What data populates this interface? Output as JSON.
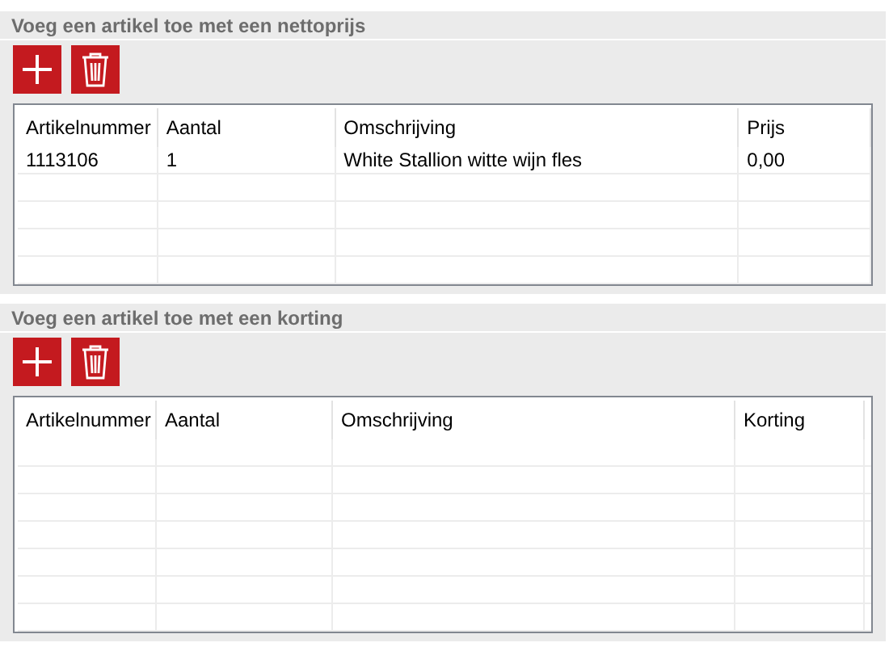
{
  "sections": [
    {
      "title": "Voeg een artikel toe met een nettoprijs",
      "columns": [
        "Artikelnummer",
        "Aantal",
        "Omschrijving",
        "Prijs"
      ],
      "rows": [
        [
          "1113106",
          "1",
          "White Stallion witte wijn fles",
          "0,00"
        ]
      ]
    },
    {
      "title": "Voeg een artikel toe met een korting",
      "columns": [
        "Artikelnummer",
        "Aantal",
        "Omschrijving",
        "Korting"
      ]
    }
  ]
}
